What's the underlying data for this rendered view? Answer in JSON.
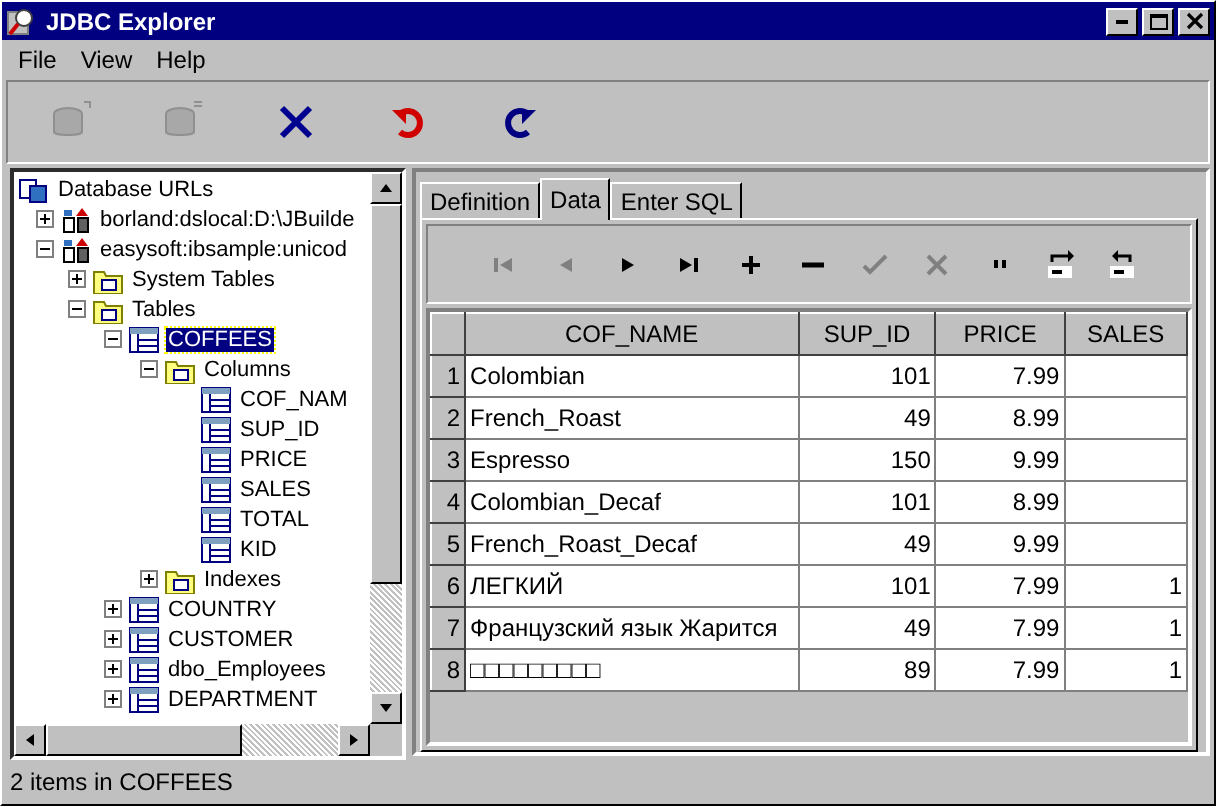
{
  "window": {
    "title": "JDBC Explorer"
  },
  "menu": [
    "File",
    "View",
    "Help"
  ],
  "toolbar": [
    {
      "kind": "db-in",
      "disabled": true
    },
    {
      "kind": "db-out",
      "disabled": true
    },
    {
      "kind": "delete",
      "disabled": false
    },
    {
      "kind": "undo",
      "disabled": false
    },
    {
      "kind": "redo",
      "disabled": false
    }
  ],
  "tree": [
    {
      "label": "Database URLs",
      "kind": "root",
      "selected": false,
      "children": [
        {
          "label": "borland:dslocal:D:\\JBuilde",
          "kind": "connection",
          "expanded": false,
          "selected": false
        },
        {
          "label": "easysoft:ibsample:unicod",
          "kind": "connection",
          "expanded": true,
          "selected": false,
          "children": [
            {
              "label": "System Tables",
              "kind": "folder",
              "expanded": false,
              "selected": false
            },
            {
              "label": "Tables",
              "kind": "folder",
              "expanded": true,
              "selected": false,
              "children": [
                {
                  "label": "COFFEES",
                  "kind": "table",
                  "expanded": true,
                  "selected": true,
                  "children": [
                    {
                      "label": "Columns",
                      "kind": "folder",
                      "expanded": true,
                      "selected": false,
                      "children": [
                        {
                          "label": "COF_NAM",
                          "kind": "column",
                          "selected": false
                        },
                        {
                          "label": "SUP_ID",
                          "kind": "column",
                          "selected": false
                        },
                        {
                          "label": "PRICE",
                          "kind": "column",
                          "selected": false
                        },
                        {
                          "label": "SALES",
                          "kind": "column",
                          "selected": false
                        },
                        {
                          "label": "TOTAL",
                          "kind": "column",
                          "selected": false
                        },
                        {
                          "label": "KID",
                          "kind": "column",
                          "selected": false
                        }
                      ]
                    },
                    {
                      "label": "Indexes",
                      "kind": "folder",
                      "expanded": false,
                      "selected": false
                    }
                  ]
                },
                {
                  "label": "COUNTRY",
                  "kind": "table",
                  "expanded": false,
                  "selected": false
                },
                {
                  "label": "CUSTOMER",
                  "kind": "table",
                  "expanded": false,
                  "selected": false
                },
                {
                  "label": "dbo_Employees",
                  "kind": "table",
                  "expanded": false,
                  "selected": false
                },
                {
                  "label": "DEPARTMENT",
                  "kind": "table",
                  "expanded": false,
                  "selected": false
                }
              ]
            }
          ]
        }
      ]
    }
  ],
  "tabs": [
    {
      "label": "Definition",
      "selected": false
    },
    {
      "label": "Data",
      "selected": true
    },
    {
      "label": "Enter SQL",
      "selected": false
    }
  ],
  "navigator": [
    {
      "kind": "first",
      "disabled": true
    },
    {
      "kind": "prior",
      "disabled": true
    },
    {
      "kind": "next",
      "disabled": false
    },
    {
      "kind": "last",
      "disabled": false
    },
    {
      "kind": "insert",
      "disabled": false
    },
    {
      "kind": "delete",
      "disabled": false
    },
    {
      "kind": "post",
      "disabled": true
    },
    {
      "kind": "cancel",
      "disabled": true
    },
    {
      "kind": "ditto",
      "disabled": false
    },
    {
      "kind": "save",
      "disabled": false
    },
    {
      "kind": "refresh",
      "disabled": false
    }
  ],
  "table": {
    "columns": [
      {
        "label": "COF_NAME",
        "kind": "text"
      },
      {
        "label": "SUP_ID",
        "kind": "number"
      },
      {
        "label": "PRICE",
        "kind": "number"
      },
      {
        "label": "SALES",
        "kind": "number"
      }
    ],
    "rows": [
      {
        "number": "1",
        "cells": [
          "Colombian",
          "101",
          "7.99",
          ""
        ]
      },
      {
        "number": "2",
        "cells": [
          "French_Roast",
          "49",
          "8.99",
          ""
        ]
      },
      {
        "number": "3",
        "cells": [
          "Espresso",
          "150",
          "9.99",
          ""
        ]
      },
      {
        "number": "4",
        "cells": [
          "Colombian_Decaf",
          "101",
          "8.99",
          ""
        ]
      },
      {
        "number": "5",
        "cells": [
          "French_Roast_Decaf",
          "49",
          "9.99",
          ""
        ]
      },
      {
        "number": "6",
        "cells": [
          "ЛЕГКИЙ",
          "101",
          "7.99",
          "1"
        ]
      },
      {
        "number": "7",
        "cells": [
          "Французский язык Жарится",
          "49",
          "7.99",
          "1"
        ]
      },
      {
        "number": "8",
        "cells": [
          "□□□□□□□□□",
          "89",
          "7.99",
          "1"
        ]
      }
    ]
  },
  "status_bar": "2 items in COFFEES"
}
